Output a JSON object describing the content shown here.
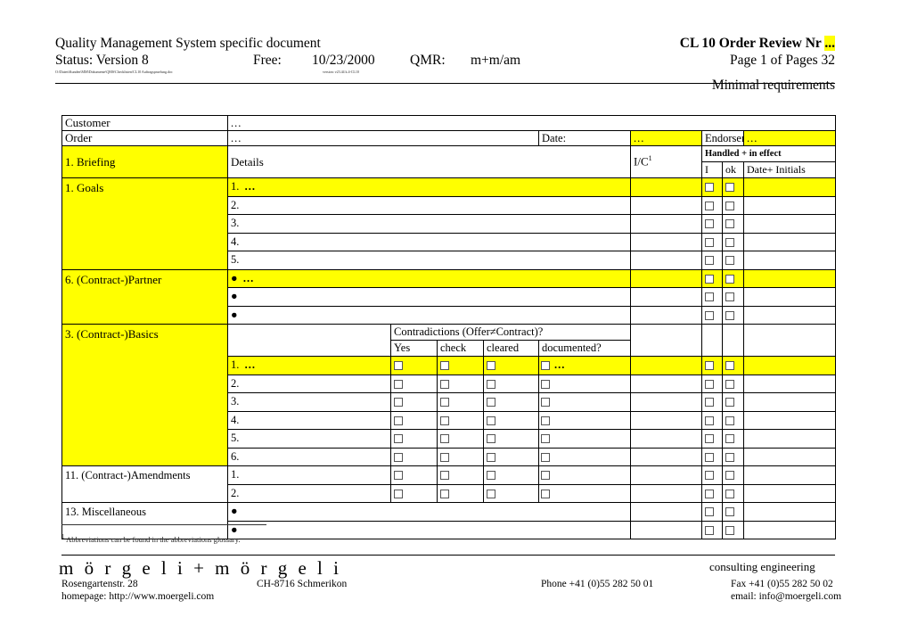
{
  "header": {
    "doc_type": "Quality Management System specific document",
    "status": "Status: Version 8",
    "free_label": "Free:",
    "free_date": "10/23/2000",
    "qmr_label": "QMR:",
    "qmr_value": "m+m/am",
    "title": "CL 10 Order Review Nr",
    "title_value": "...",
    "page_info": "Page 1 of Pages 32",
    "subtitle": "Minimal requirements",
    "path_note": "O:\\Daten\\Kunden\\MM\\Dokumente\\QMS\\Checklisten\\CL10 Auftragspruefung.doc",
    "version_note": "version: v23.44 k.4-CL10"
  },
  "info": {
    "customer_label": "Customer",
    "customer_value": "...",
    "order_label": "Order",
    "order_value": "...",
    "date_label": "Date:",
    "date_value": "...",
    "endorsement_label": "Endorsement:",
    "endorsement_value": "..."
  },
  "table_header": {
    "section_label": "1.  Briefing",
    "details_label": "Details",
    "ic_label": "I/C",
    "ic_sup": "1",
    "handled_label": "Handled + in effect",
    "i_label": "I",
    "ok_label": "ok",
    "date_initials_label": "Date+ Initials",
    "contradictions_label": "Contradictions (Offer≠Contract)?",
    "yes_label": "Yes",
    "check_label": "check",
    "cleared_label": "cleared",
    "documented_label": "documented?"
  },
  "sections": [
    {
      "label": "1.   Goals",
      "rows": [
        {
          "marker": "1.",
          "value": "...",
          "highlight": true
        },
        {
          "marker": "2.",
          "value": "",
          "highlight": false
        },
        {
          "marker": "3.",
          "value": "",
          "highlight": false
        },
        {
          "marker": "4.",
          "value": "",
          "highlight": false
        },
        {
          "marker": "5.",
          "value": "",
          "highlight": false
        }
      ]
    },
    {
      "label": "6.   (Contract-)Partner",
      "rows": [
        {
          "marker": "●",
          "value": "...",
          "highlight": true
        },
        {
          "marker": "●",
          "value": "",
          "highlight": false
        },
        {
          "marker": "●",
          "value": "",
          "highlight": false
        }
      ]
    },
    {
      "label": "3.   (Contract-)Basics",
      "rows": [
        {
          "marker": "1.",
          "value": "...",
          "highlight": true,
          "documented_value": "..."
        },
        {
          "marker": "2.",
          "value": "",
          "highlight": false,
          "documented_value": ""
        },
        {
          "marker": "3.",
          "value": "",
          "highlight": false,
          "documented_value": ""
        },
        {
          "marker": "4.",
          "value": "",
          "highlight": false,
          "documented_value": ""
        },
        {
          "marker": "5.",
          "value": "",
          "highlight": false,
          "documented_value": ""
        },
        {
          "marker": "6.",
          "value": "",
          "highlight": false,
          "documented_value": ""
        }
      ]
    },
    {
      "label": "11. (Contract-)Amendments",
      "rows": [
        {
          "marker": "1.",
          "value": "",
          "highlight": false,
          "documented_value": ""
        },
        {
          "marker": "2.",
          "value": "",
          "highlight": false,
          "documented_value": ""
        }
      ]
    },
    {
      "label": "13. Miscellaneous",
      "rows": [
        {
          "marker": "●",
          "value": "",
          "highlight": false
        },
        {
          "marker": "●",
          "value": "",
          "highlight": false
        }
      ]
    }
  ],
  "footnote": {
    "marker": "1",
    "text": "Abbreviations can be found in the abbreviations glossary."
  },
  "footer": {
    "logo": "m ö r g e l i  +  m ö r g e l i",
    "tagline": "consulting  engineering",
    "street": "Rosengartenstr. 28",
    "city": "CH-8716 Schmerikon",
    "phone": "Phone +41 (0)55 282 50 01",
    "fax": "Fax +41 (0)55 282 50 02",
    "homepage": "homepage: http://www.moergeli.com",
    "email": "email: info@moergeli.com"
  },
  "colors": {
    "highlight": "#ffff00",
    "text": "#000000",
    "border": "#000000"
  }
}
